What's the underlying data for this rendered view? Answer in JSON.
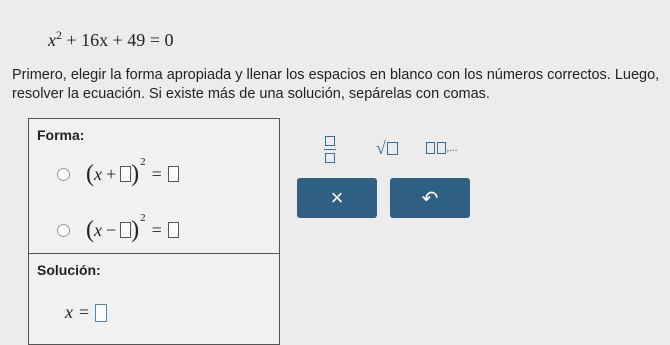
{
  "problem": {
    "eq_lhs_var": "x",
    "eq_exp": "2",
    "eq_rest": "+ 16x + 49 = 0",
    "instructions": "Primero, elegir la forma apropiada y llenar los espacios en blanco con los números correctos. Luego, resolver la ecuación. Si existe más de una solución, sepárelas con comas."
  },
  "forma": {
    "title": "Forma:",
    "options": [
      {
        "var": "x",
        "op": "+",
        "exp": "2",
        "eq": "="
      },
      {
        "var": "x",
        "op": "−",
        "exp": "2",
        "eq": "="
      }
    ]
  },
  "solucion": {
    "title": "Solución:",
    "var": "x",
    "eq": "="
  },
  "keypad": {
    "sqrt_symbol": "√",
    "list_suffix": ",..."
  },
  "buttons": {
    "clear": "×",
    "undo": "↶"
  }
}
